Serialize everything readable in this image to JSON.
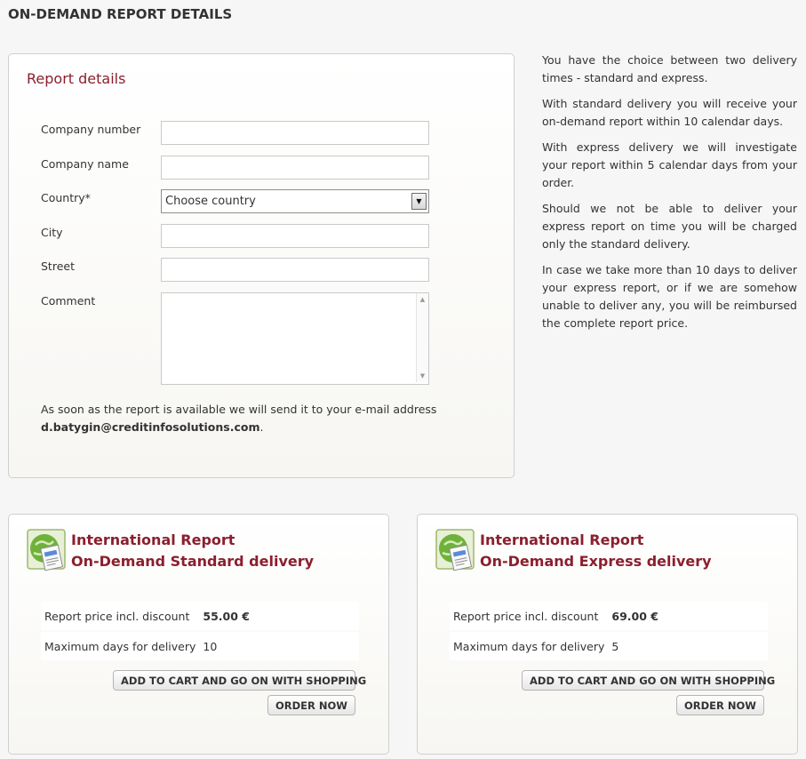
{
  "page": {
    "title": "ON-DEMAND REPORT DETAILS"
  },
  "form": {
    "heading": "Report details",
    "fields": {
      "company_number": {
        "label": "Company number",
        "value": ""
      },
      "company_name": {
        "label": "Company name",
        "value": ""
      },
      "country": {
        "label": "Country*",
        "value": "Choose country"
      },
      "city": {
        "label": "City",
        "value": ""
      },
      "street": {
        "label": "Street",
        "value": ""
      },
      "comment": {
        "label": "Comment",
        "value": ""
      }
    },
    "notice": {
      "text": "As soon as the report is available we will send it to your e-mail address",
      "email": "d.batygin@creditinfosolutions.com",
      "suffix": "."
    }
  },
  "info": {
    "paragraphs": [
      "You have the choice between two delivery times - standard and express.",
      "With standard delivery you will receive your on-demand report within 10 calendar days.",
      "With express delivery we will investigate your report within 5 calendar days from your order.",
      "Should we not be able to deliver your express report on time you will be charged only the standard delivery.",
      "In case we take more than 10 days to deliver your express report, or if we are somehow unable to deliver any, you will be reimbursed the complete report price."
    ]
  },
  "products": [
    {
      "title": "International Report",
      "subtitle": "On-Demand Standard delivery",
      "price_label": "Report price incl. discount",
      "price_value": "55.00 €",
      "days_label": "Maximum days for delivery",
      "days_value": "10",
      "cart_button": "ADD TO CART AND GO ON WITH SHOPPING",
      "order_button": "ORDER NOW",
      "icon": "report-document-globe-icon"
    },
    {
      "title": "International Report",
      "subtitle": "On-Demand Express delivery",
      "price_label": "Report price incl. discount",
      "price_value": "69.00 €",
      "days_label": "Maximum days for delivery",
      "days_value": "5",
      "cart_button": "ADD TO CART AND GO ON WITH SHOPPING",
      "order_button": "ORDER NOW",
      "icon": "report-document-globe-icon"
    }
  ],
  "colors": {
    "accent": "#8b1f2e",
    "panel_border": "#cfcfcf",
    "background": "#f6f6f6"
  }
}
